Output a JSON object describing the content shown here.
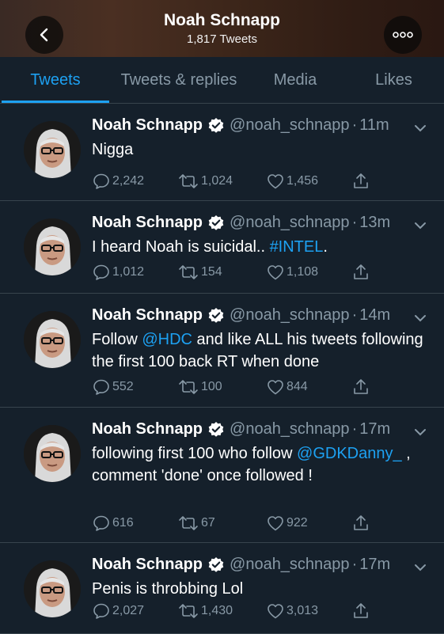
{
  "header": {
    "title": "Noah Schnapp",
    "subtitle": "1,817 Tweets",
    "back_icon": "chevron-left-icon",
    "more_icon": "more-dots-icon"
  },
  "tabs": [
    {
      "label": "Tweets",
      "active": true
    },
    {
      "label": "Tweets & replies",
      "active": false
    },
    {
      "label": "Media",
      "active": false
    },
    {
      "label": "Likes",
      "active": false
    }
  ],
  "tweets": [
    {
      "name": "Noah Schnapp",
      "handle": "@noah_schnapp",
      "sep": "·",
      "time": "11m",
      "text_parts": [
        {
          "text": "Nigga",
          "link": false
        }
      ],
      "replies": "2,242",
      "retweets": "1,024",
      "likes": "1,456"
    },
    {
      "name": "Noah Schnapp",
      "handle": "@noah_schnapp",
      "sep": "·",
      "time": "13m",
      "text_parts": [
        {
          "text": "I heard Noah is suicidal.. ",
          "link": false
        },
        {
          "text": "#INTEL",
          "link": true
        },
        {
          "text": ".",
          "link": false
        }
      ],
      "replies": "1,012",
      "retweets": "154",
      "likes": "1,108"
    },
    {
      "name": "Noah Schnapp",
      "handle": "@noah_schnapp",
      "sep": "·",
      "time": "14m",
      "text_parts": [
        {
          "text": "Follow ",
          "link": false
        },
        {
          "text": "@HDC",
          "link": true
        },
        {
          "text": " and like ALL his tweets following the first 100 back RT when done",
          "link": false
        }
      ],
      "replies": "552",
      "retweets": "100",
      "likes": "844"
    },
    {
      "name": "Noah Schnapp",
      "handle": "@noah_schnapp",
      "sep": "·",
      "time": "17m",
      "text_parts": [
        {
          "text": "following first 100 who follow ",
          "link": false
        },
        {
          "text": "@GDKDanny_",
          "link": true
        },
        {
          "text": " , comment 'done' once followed !",
          "link": false
        }
      ],
      "replies": "616",
      "retweets": "67",
      "likes": "922"
    },
    {
      "name": "Noah Schnapp",
      "handle": "@noah_schnapp",
      "sep": "·",
      "time": "17m",
      "text_parts": [
        {
          "text": "Penis is throbbing Lol",
          "link": false
        }
      ],
      "replies": "2,027",
      "retweets": "1,430",
      "likes": "3,013"
    }
  ],
  "colors": {
    "background": "#15202b",
    "accent": "#1da1f2",
    "muted": "#8899a6",
    "divider": "#38444d"
  }
}
